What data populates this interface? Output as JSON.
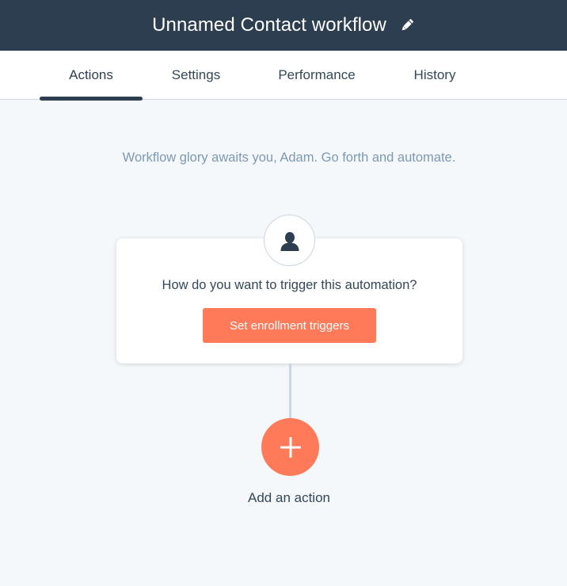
{
  "header": {
    "title": "Unnamed Contact workflow",
    "edit_icon": "pencil-icon"
  },
  "tabs": [
    {
      "label": "Actions",
      "active": true
    },
    {
      "label": "Settings",
      "active": false
    },
    {
      "label": "Performance",
      "active": false
    },
    {
      "label": "History",
      "active": false
    }
  ],
  "main": {
    "greeting": "Workflow glory awaits you, Adam. Go forth and automate.",
    "trigger_card": {
      "icon": "contact-icon",
      "question": "How do you want to trigger this automation?",
      "button_label": "Set enrollment triggers"
    },
    "add_action": {
      "icon": "plus-icon",
      "label": "Add an action"
    }
  },
  "colors": {
    "header_bg": "#2d3e50",
    "accent": "#ff7a59",
    "page_bg": "#f5f8fa",
    "muted_text": "#7c98b6",
    "text": "#33475b"
  }
}
